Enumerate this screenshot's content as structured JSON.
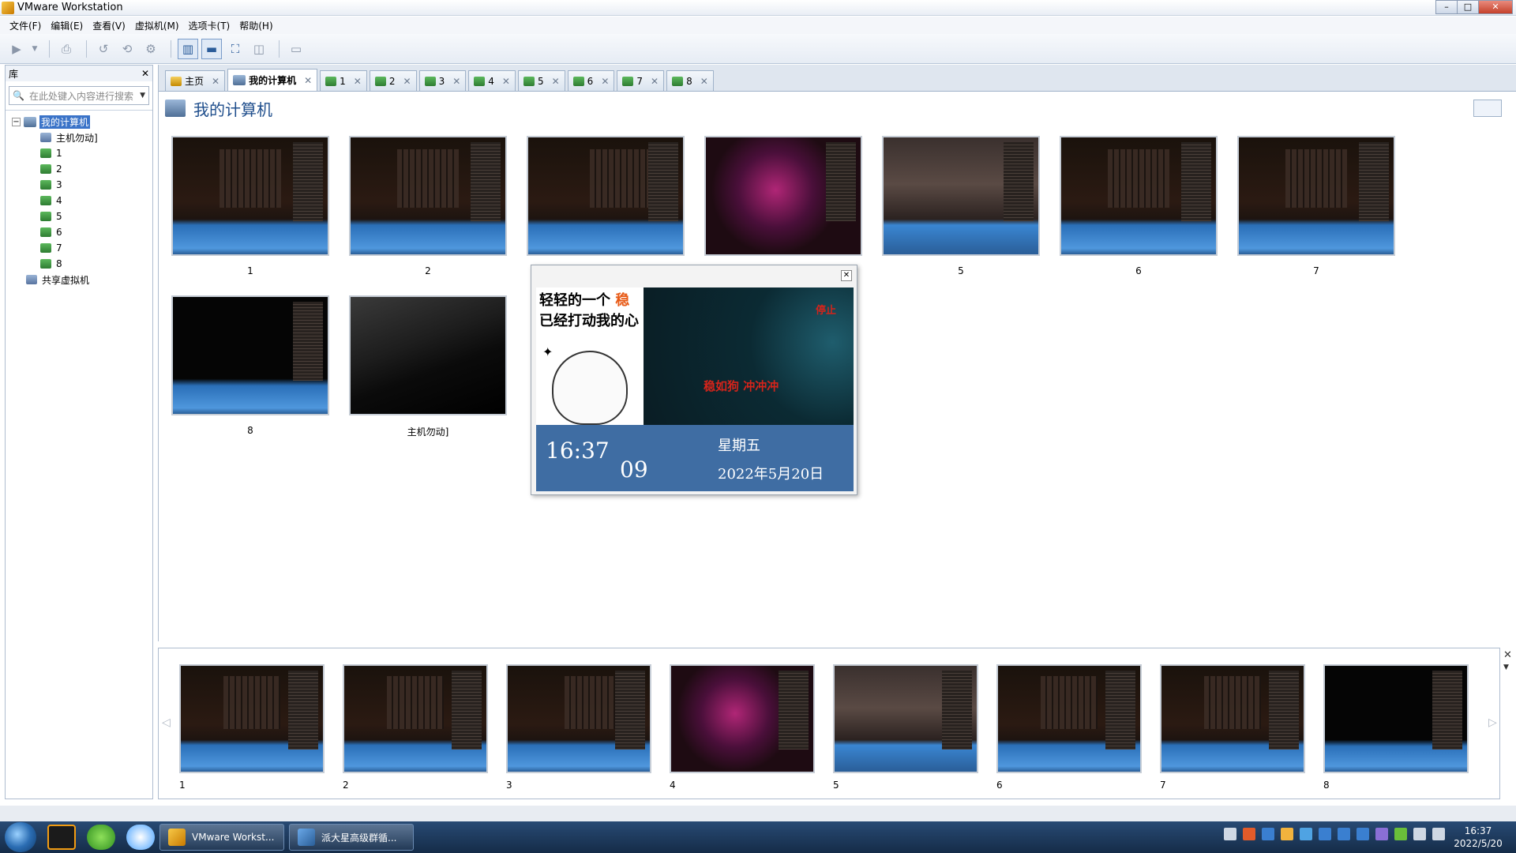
{
  "window": {
    "title": "VMware Workstation"
  },
  "menu": [
    "文件(F)",
    "编辑(E)",
    "查看(V)",
    "虚拟机(M)",
    "选项卡(T)",
    "帮助(H)"
  ],
  "library": {
    "title": "库",
    "search_placeholder": "在此处键入内容进行搜索",
    "root": "我的计算机",
    "items": [
      "主机勿动]",
      "1",
      "2",
      "3",
      "4",
      "5",
      "6",
      "7",
      "8"
    ],
    "shared": "共享虚拟机"
  },
  "tabs": [
    {
      "label": "主页",
      "type": "home"
    },
    {
      "label": "我的计算机",
      "type": "pc",
      "active": true
    },
    {
      "label": "1",
      "type": "vm"
    },
    {
      "label": "2",
      "type": "vm"
    },
    {
      "label": "3",
      "type": "vm"
    },
    {
      "label": "4",
      "type": "vm"
    },
    {
      "label": "5",
      "type": "vm"
    },
    {
      "label": "6",
      "type": "vm"
    },
    {
      "label": "7",
      "type": "vm"
    },
    {
      "label": "8",
      "type": "vm"
    }
  ],
  "page": {
    "title": "我的计算机"
  },
  "thumbnails": [
    "1",
    "2",
    "3",
    "4",
    "5",
    "6",
    "7",
    "8",
    "主机勿动]"
  ],
  "popup": {
    "meme_line1_a": "轻轻的一个",
    "meme_line1_b": "稳",
    "meme_line2": "已经打动我的心",
    "stop": "停止",
    "slogan": "稳如狗  冲冲冲",
    "time_hm": "16:37",
    "time_sec": "09",
    "weekday": "星期五",
    "date": "2022年5月20日"
  },
  "strip": [
    "1",
    "2",
    "3",
    "4",
    "5",
    "6",
    "7",
    "8"
  ],
  "taskbar": {
    "items": [
      "VMware Workst...",
      "派大星高级群循..."
    ],
    "time": "16:37",
    "date": "2022/5/20"
  }
}
